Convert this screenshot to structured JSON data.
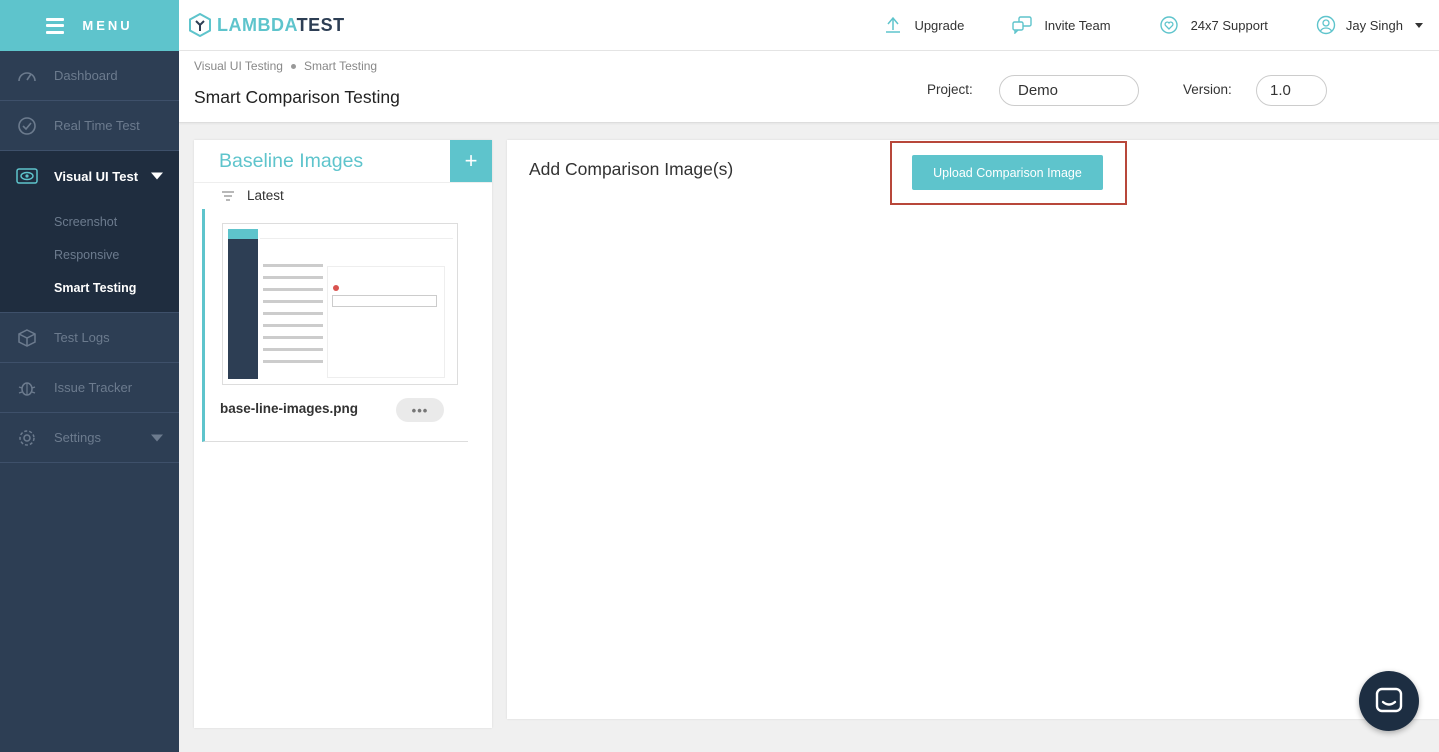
{
  "sidebar": {
    "menu_label": "MENU",
    "items": [
      {
        "label": "Dashboard",
        "icon": "speedometer-icon"
      },
      {
        "label": "Real Time Test",
        "icon": "clock-icon"
      },
      {
        "label": "Visual UI Test",
        "icon": "eye-icon",
        "active": true
      },
      {
        "label": "Test Logs",
        "icon": "cube-icon"
      },
      {
        "label": "Issue Tracker",
        "icon": "bug-icon"
      },
      {
        "label": "Settings",
        "icon": "gear-icon"
      }
    ],
    "sub_items": [
      {
        "label": "Screenshot"
      },
      {
        "label": "Responsive"
      },
      {
        "label": "Smart Testing",
        "current": true
      }
    ]
  },
  "header": {
    "logo_left": "LAMBDA",
    "logo_right": "TEST",
    "upgrade": "Upgrade",
    "invite": "Invite Team",
    "support": "24x7 Support",
    "user": "Jay Singh"
  },
  "subheader": {
    "breadcrumb": [
      "Visual UI Testing",
      "Smart Testing"
    ],
    "title": "Smart Comparison Testing",
    "project_label": "Project:",
    "project_value": "Demo",
    "version_label": "Version:",
    "version_value": "1.0"
  },
  "baseline": {
    "title": "Baseline Images",
    "add_label": "+",
    "filter_label": "Latest",
    "file_name": "base-line-images.png",
    "more_label": "•••"
  },
  "comparison": {
    "title": "Add Comparison Image(s)",
    "upload_label": "Upload Comparison Image"
  },
  "colors": {
    "accent": "#5ec4cc",
    "sidebar": "#2d3e54",
    "highlight": "#b8473a"
  }
}
